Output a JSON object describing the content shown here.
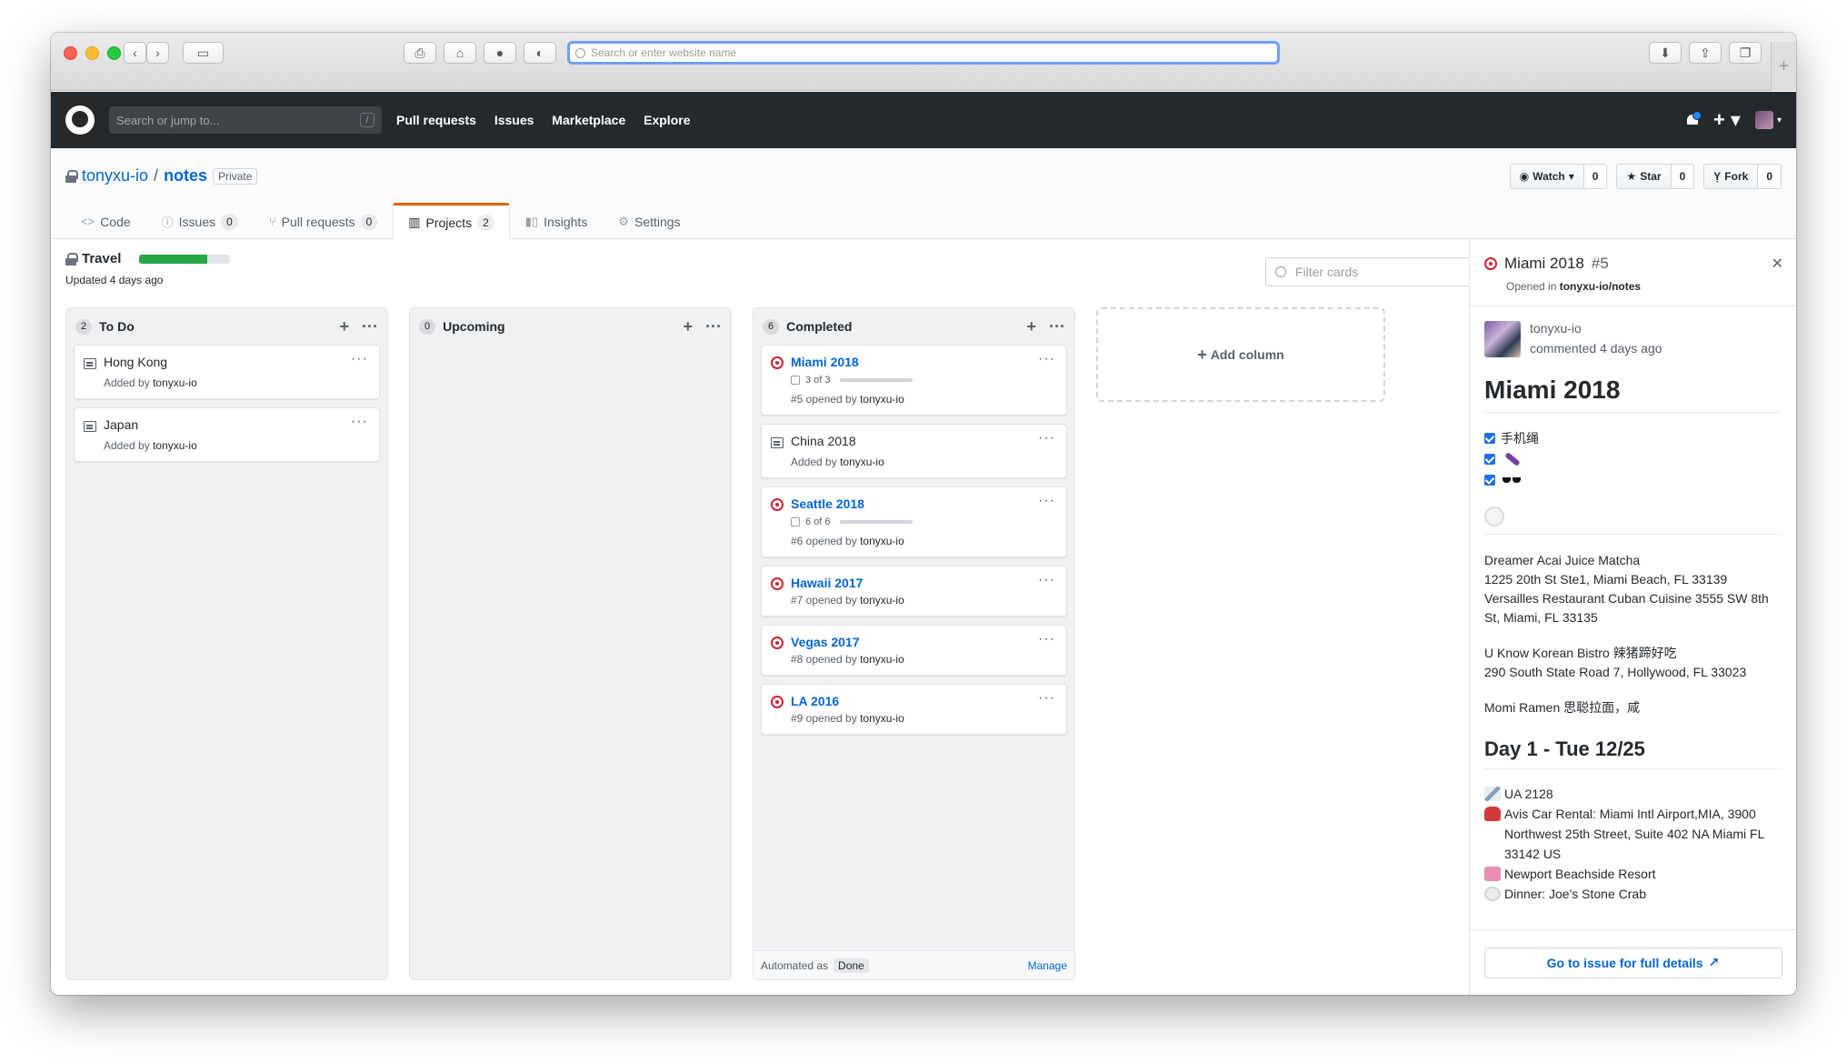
{
  "browser": {
    "address_placeholder": "Search or enter website name"
  },
  "header": {
    "search_placeholder": "Search or jump to...",
    "search_shortcut": "/",
    "nav": [
      "Pull requests",
      "Issues",
      "Marketplace",
      "Explore"
    ]
  },
  "repo": {
    "owner": "tonyxu-io",
    "separator": "/",
    "name": "notes",
    "visibility": "Private",
    "actions": {
      "watch": {
        "label": "Watch",
        "count": "0"
      },
      "star": {
        "label": "Star",
        "count": "0"
      },
      "fork": {
        "label": "Fork",
        "count": "0"
      }
    },
    "tabs": [
      {
        "label": "Code",
        "count": ""
      },
      {
        "label": "Issues",
        "count": "0"
      },
      {
        "label": "Pull requests",
        "count": "0"
      },
      {
        "label": "Projects",
        "count": "2"
      },
      {
        "label": "Insights",
        "count": ""
      },
      {
        "label": "Settings",
        "count": ""
      }
    ]
  },
  "project": {
    "name": "Travel",
    "progress": 0.75,
    "updated": "Updated 4 days ago",
    "filter_placeholder": "Filter cards"
  },
  "columns": [
    {
      "count": "2",
      "name": "To Do",
      "cards": [
        {
          "title": "Hong Kong",
          "meta_prefix": "Added by",
          "user": "tonyxu-io"
        },
        {
          "title": "Japan",
          "meta_prefix": "Added by",
          "user": "tonyxu-io"
        }
      ]
    },
    {
      "count": "0",
      "name": "Upcoming",
      "cards": []
    },
    {
      "count": "6",
      "name": "Completed",
      "cards": [
        {
          "title": "Miami 2018",
          "checklist": "3 of 3",
          "meta_prefix": "#5 opened by",
          "user": "tonyxu-io"
        },
        {
          "title": "China 2018",
          "meta_prefix": "Added by",
          "user": "tonyxu-io"
        },
        {
          "title": "Seattle 2018",
          "checklist": "6 of 6",
          "meta_prefix": "#6 opened by",
          "user": "tonyxu-io"
        },
        {
          "title": "Hawaii 2017",
          "meta_prefix": "#7 opened by",
          "user": "tonyxu-io"
        },
        {
          "title": "Vegas 2017",
          "meta_prefix": "#8 opened by",
          "user": "tonyxu-io"
        },
        {
          "title": "LA 2016",
          "meta_prefix": "#9 opened by",
          "user": "tonyxu-io"
        }
      ],
      "footer": {
        "automated_label": "Automated as",
        "automated_value": "Done",
        "manage": "Manage"
      }
    }
  ],
  "add_column": "Add column",
  "panel": {
    "title": "Miami 2018",
    "number": "#5",
    "opened_prefix": "Opened in",
    "opened_repo": "tonyxu-io/notes",
    "author": "tonyxu-io",
    "commented": "commented 4 days ago",
    "heading": "Miami 2018",
    "tasks": [
      "手机绳",
      "",
      ""
    ],
    "paragraph1": [
      "Dreamer Acai Juice Matcha",
      "1225 20th St Ste1, Miami Beach, FL 33139",
      "Versailles Restaurant Cuban Cuisine 3555 SW 8th St, Miami, FL 33135"
    ],
    "paragraph2": [
      "U Know Korean Bistro 辣猪蹄好吃",
      "290 South State Road 7, Hollywood, FL 33023"
    ],
    "paragraph3": "Momi Ramen 思聪拉面，咸",
    "day_heading": "Day 1 - Tue 12/25",
    "day_items": [
      {
        "icon": "airplane-icon",
        "text": "UA 2128"
      },
      {
        "icon": "car-icon",
        "text": "Avis Car Rental: Miami Intl Airport,MIA, 3900 Northwest 25th Street, Suite 402 NA Miami FL 33142 US"
      },
      {
        "icon": "hotel-icon",
        "text": "Newport Beachside Resort"
      },
      {
        "icon": "plate-icon",
        "text": "Dinner: Joe's Stone Crab"
      }
    ],
    "go_button": "Go to issue for full details"
  }
}
